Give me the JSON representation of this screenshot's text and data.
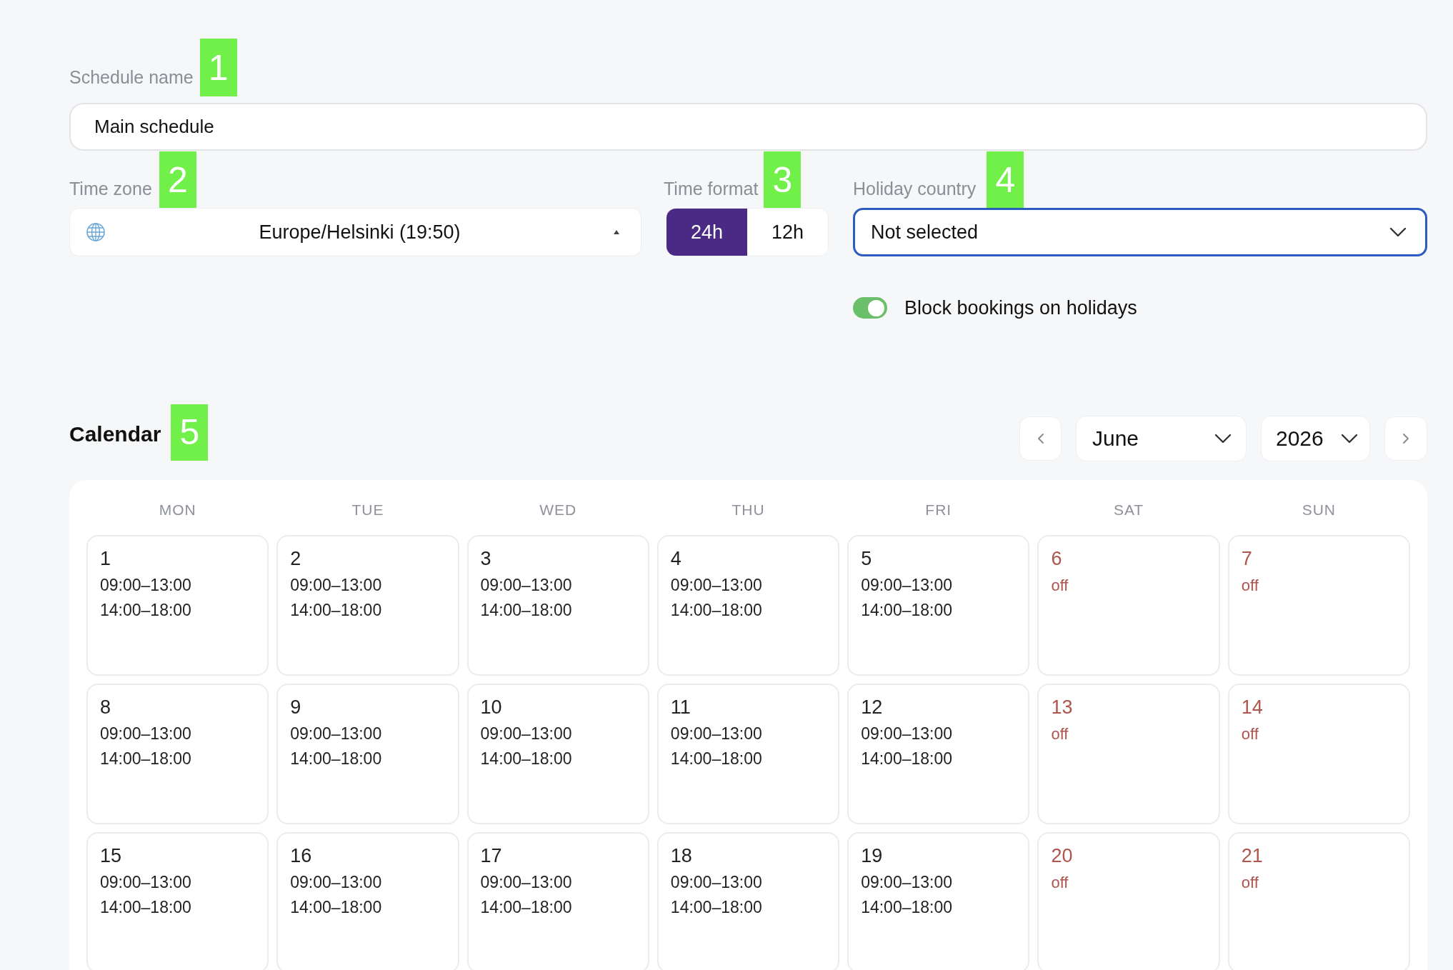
{
  "schedule_name": {
    "label": "Schedule name",
    "marker": "1",
    "value": "Main schedule"
  },
  "time_zone": {
    "label": "Time zone",
    "marker": "2",
    "value": "Europe/Helsinki (19:50)"
  },
  "time_format": {
    "label": "Time format",
    "marker": "3",
    "options": [
      {
        "label": "24h",
        "selected": true
      },
      {
        "label": "12h",
        "selected": false
      }
    ]
  },
  "holiday_country": {
    "label": "Holiday country",
    "marker": "4",
    "value": "Not selected",
    "focused": true
  },
  "block_bookings": {
    "label": "Block bookings on holidays",
    "on": true
  },
  "calendar": {
    "title": "Calendar",
    "marker": "5",
    "month": "June",
    "year": "2026",
    "weekdays": [
      "MON",
      "TUE",
      "WED",
      "THU",
      "FRI",
      "SAT",
      "SUN"
    ],
    "weeks": [
      [
        {
          "day": "1",
          "kind": "workday",
          "hours": [
            "09:00–13:00",
            "14:00–18:00"
          ]
        },
        {
          "day": "2",
          "kind": "workday",
          "hours": [
            "09:00–13:00",
            "14:00–18:00"
          ]
        },
        {
          "day": "3",
          "kind": "workday",
          "hours": [
            "09:00–13:00",
            "14:00–18:00"
          ]
        },
        {
          "day": "4",
          "kind": "workday",
          "hours": [
            "09:00–13:00",
            "14:00–18:00"
          ]
        },
        {
          "day": "5",
          "kind": "workday",
          "hours": [
            "09:00–13:00",
            "14:00–18:00"
          ]
        },
        {
          "day": "6",
          "kind": "day_off",
          "note": "off"
        },
        {
          "day": "7",
          "kind": "day_off",
          "note": "off"
        }
      ],
      [
        {
          "day": "8",
          "kind": "workday",
          "hours": [
            "09:00–13:00",
            "14:00–18:00"
          ]
        },
        {
          "day": "9",
          "kind": "workday",
          "hours": [
            "09:00–13:00",
            "14:00–18:00"
          ]
        },
        {
          "day": "10",
          "kind": "workday",
          "hours": [
            "09:00–13:00",
            "14:00–18:00"
          ]
        },
        {
          "day": "11",
          "kind": "workday",
          "hours": [
            "09:00–13:00",
            "14:00–18:00"
          ]
        },
        {
          "day": "12",
          "kind": "workday",
          "hours": [
            "09:00–13:00",
            "14:00–18:00"
          ]
        },
        {
          "day": "13",
          "kind": "day_off",
          "note": "off"
        },
        {
          "day": "14",
          "kind": "day_off",
          "note": "off"
        }
      ],
      [
        {
          "day": "15",
          "kind": "workday",
          "hours": [
            "09:00–13:00",
            "14:00–18:00"
          ]
        },
        {
          "day": "16",
          "kind": "workday",
          "hours": [
            "09:00–13:00",
            "14:00–18:00"
          ]
        },
        {
          "day": "17",
          "kind": "workday",
          "hours": [
            "09:00–13:00",
            "14:00–18:00"
          ]
        },
        {
          "day": "18",
          "kind": "workday",
          "hours": [
            "09:00–13:00",
            "14:00–18:00"
          ]
        },
        {
          "day": "19",
          "kind": "workday",
          "hours": [
            "09:00–13:00",
            "14:00–18:00"
          ]
        },
        {
          "day": "20",
          "kind": "day_off",
          "note": "off"
        },
        {
          "day": "21",
          "kind": "day_off",
          "note": "off"
        }
      ]
    ]
  }
}
